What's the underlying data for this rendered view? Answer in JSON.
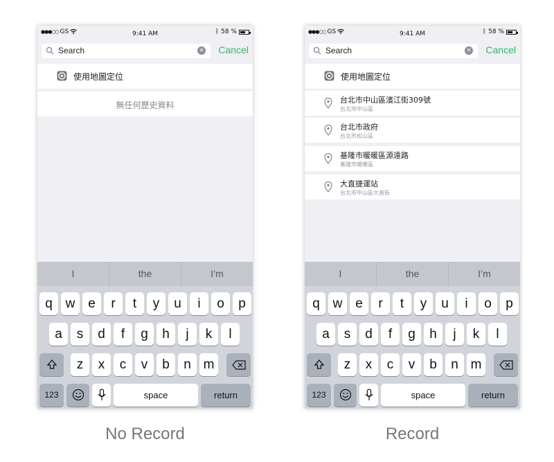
{
  "screens": {
    "left": {
      "status": {
        "carrier": "GS",
        "time": "9:41 AM",
        "battery": "58 %"
      },
      "search": {
        "text": "Search",
        "cancel": "Cancel"
      },
      "use_location": "使用地圖定位",
      "empty_message": "無任何歷史資料",
      "caption": "No Record"
    },
    "right": {
      "status": {
        "carrier": "GS",
        "time": "9:41 AM",
        "battery": "58 %"
      },
      "search": {
        "text": "Search",
        "cancel": "Cancel"
      },
      "use_location": "使用地圖定位",
      "results": [
        {
          "title": "台北市中山區濱江街309號",
          "subtitle": "台北市中山區"
        },
        {
          "title": "台北市政府",
          "subtitle": "台北市松山區"
        },
        {
          "title": "基隆市暖暖區源遠路",
          "subtitle": "基隆市暖暖區"
        },
        {
          "title": "大直捷運站",
          "subtitle": "台北市中山區大直街"
        }
      ],
      "caption": "Record"
    }
  },
  "keyboard": {
    "predictions": [
      "I",
      "the",
      "I’m"
    ],
    "row1": [
      "q",
      "w",
      "e",
      "r",
      "t",
      "y",
      "u",
      "i",
      "o",
      "p"
    ],
    "row2": [
      "a",
      "s",
      "d",
      "f",
      "g",
      "h",
      "j",
      "k",
      "l"
    ],
    "row3": [
      "z",
      "x",
      "c",
      "v",
      "b",
      "n",
      "m"
    ],
    "numbers_label": "123",
    "space_label": "space",
    "return_label": "return"
  },
  "colors": {
    "accent": "#34b66a",
    "keyboard_bg": "#d1d5db",
    "prediction_bg": "#c4c8ce"
  }
}
